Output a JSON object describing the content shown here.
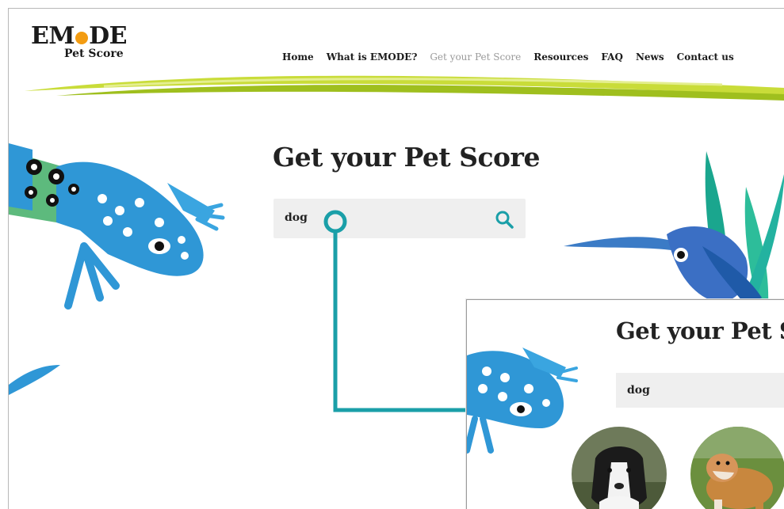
{
  "logo": {
    "main_left": "EM",
    "main_right": "DE",
    "sub": "Pet Score"
  },
  "nav": {
    "items": [
      {
        "label": "Home",
        "active": false
      },
      {
        "label": "What is EMODE?",
        "active": false
      },
      {
        "label": "Get your Pet Score",
        "active": true
      },
      {
        "label": "Resources",
        "active": false
      },
      {
        "label": "FAQ",
        "active": false
      },
      {
        "label": "News",
        "active": false
      },
      {
        "label": "Contact us",
        "active": false
      }
    ]
  },
  "main": {
    "title": "Get your Pet Score",
    "search": {
      "value": "dog"
    }
  },
  "inset": {
    "title": "Get your Pet S",
    "search": {
      "value": "dog"
    },
    "results": [
      {
        "icon": "border-collie-photo"
      },
      {
        "icon": "bulldog-photo"
      }
    ]
  },
  "colors": {
    "accent_teal": "#1a9fa8",
    "swoosh_green": "#b5cd1f",
    "lizard_blue": "#2f97d6",
    "lizard_green": "#5dba7d",
    "logo_orange": "#f39c12"
  }
}
